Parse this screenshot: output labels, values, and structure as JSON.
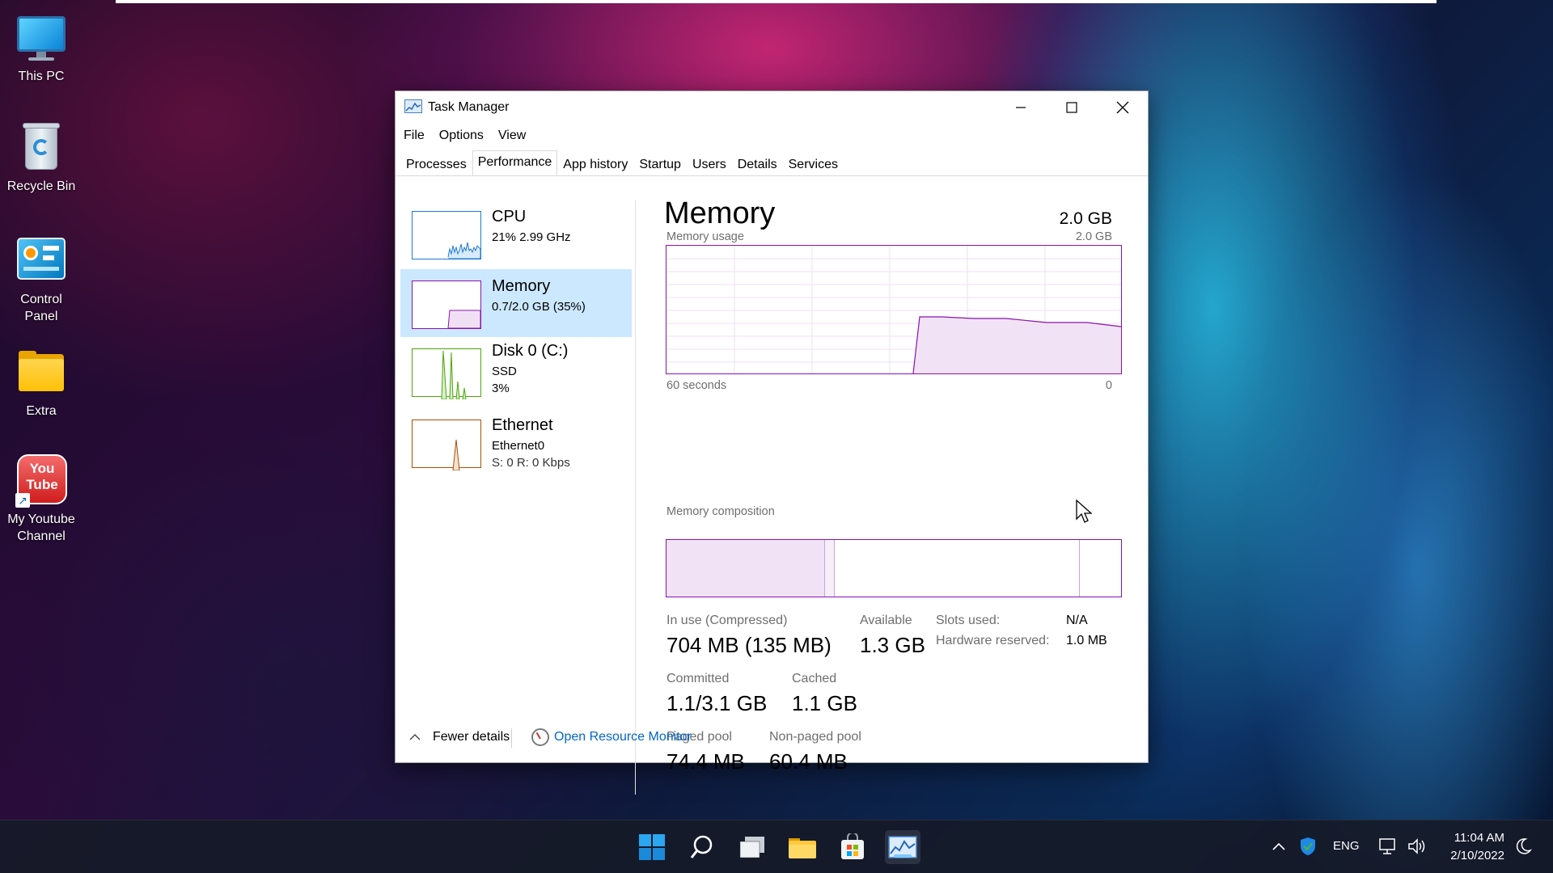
{
  "desktop": {
    "icons": [
      {
        "label_line1": "This PC",
        "label_line2": ""
      },
      {
        "label_line1": "Recycle Bin",
        "label_line2": ""
      },
      {
        "label_line1": "Control",
        "label_line2": "Panel"
      },
      {
        "label_line1": "Extra",
        "label_line2": ""
      },
      {
        "label_line1": "My Youtube",
        "label_line2": "Channel"
      }
    ],
    "youtube_badge": {
      "line1": "You",
      "line2": "Tube"
    }
  },
  "window": {
    "title": "Task Manager",
    "menu": [
      "File",
      "Options",
      "View"
    ],
    "tabs": [
      "Processes",
      "Performance",
      "App history",
      "Startup",
      "Users",
      "Details",
      "Services"
    ],
    "active_tab": "Performance"
  },
  "sidebar": {
    "items": [
      {
        "title": "CPU",
        "sub1": "21% 2.99 GHz",
        "sub2": "",
        "sub3": "",
        "color": "#1f7ad1"
      },
      {
        "title": "Memory",
        "sub1": "0.7/2.0 GB (35%)",
        "sub2": "",
        "sub3": "",
        "color": "#8b12ae"
      },
      {
        "title": "Disk 0 (C:)",
        "sub1": "SSD",
        "sub2": "3%",
        "sub3": "",
        "color": "#4da60c"
      },
      {
        "title": "Ethernet",
        "sub1": "Ethernet0",
        "sub2": "S: 0 R: 0 Kbps",
        "sub3": "",
        "color": "#a74f01"
      }
    ],
    "selected": "Memory"
  },
  "memory": {
    "title": "Memory",
    "total": "2.0 GB",
    "usage_label": "Memory usage",
    "usage_max": "2.0 GB",
    "axis_left": "60 seconds",
    "axis_right": "0",
    "composition_label": "Memory composition",
    "in_use_label": "In use (Compressed)",
    "in_use_value": "704 MB (135 MB)",
    "available_label": "Available",
    "available_value": "1.3 GB",
    "committed_label": "Committed",
    "committed_value": "1.1/3.1 GB",
    "cached_label": "Cached",
    "cached_value": "1.1 GB",
    "paged_label": "Paged pool",
    "paged_value": "74.4 MB",
    "nonpaged_label": "Non-paged pool",
    "nonpaged_value": "60.4 MB",
    "slots_label": "Slots used:",
    "slots_value": "N/A",
    "hw_label": "Hardware reserved:",
    "hw_value": "1.0 MB"
  },
  "footer": {
    "fewer_details": "Fewer details",
    "resource_monitor": "Open Resource Monitor"
  },
  "tray": {
    "language": "ENG",
    "time": "11:04 AM",
    "date": "2/10/2022"
  }
}
